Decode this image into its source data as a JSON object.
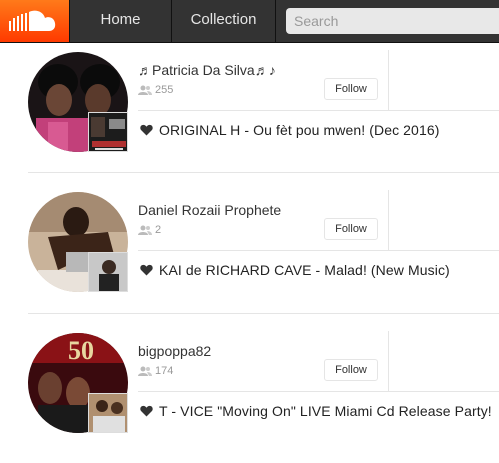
{
  "header": {
    "logo_icon": "soundcloud-cloud-icon",
    "brand_color": "#ff5500",
    "tabs": [
      {
        "label": "Home"
      },
      {
        "label": "Collection"
      }
    ],
    "search": {
      "placeholder": "Search",
      "value": ""
    }
  },
  "feed": [
    {
      "username": "♬Patricia Da Silva♬♪",
      "followers": "255",
      "follow_label": "Follow",
      "track": "ORIGINAL H - Ou fèt pou mwen! (Dec 2016)",
      "action_icon": "heart-icon"
    },
    {
      "username": "Daniel Rozaii Prophete",
      "followers": "2",
      "follow_label": "Follow",
      "track": "KAI de RICHARD CAVE - Malad! (New Music)",
      "action_icon": "heart-icon"
    },
    {
      "username": "bigpoppa82",
      "followers": "174",
      "follow_label": "Follow",
      "track": "T - VICE \"Moving On\" LIVE Miami Cd Release Party!",
      "action_icon": "heart-icon"
    }
  ]
}
